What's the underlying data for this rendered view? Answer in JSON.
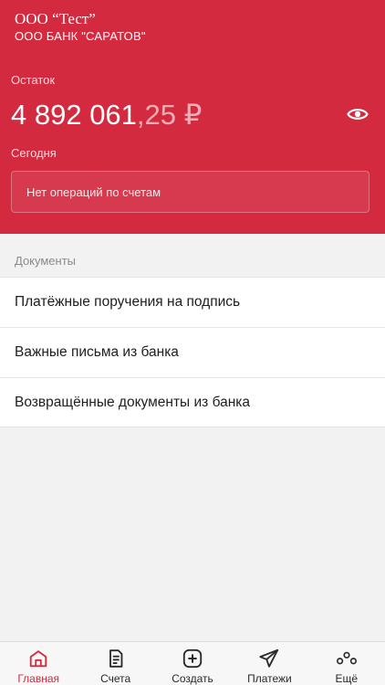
{
  "header": {
    "org_name": "ООО “Тест”",
    "bank_name": "ООО БАНК \"САРАТОВ\"",
    "balance_label": "Остаток",
    "balance_whole": "4 892 061",
    "balance_fraction": ",25 ₽",
    "today_label": "Сегодня",
    "no_operations": "Нет операций по счетам"
  },
  "documents": {
    "title": "Документы",
    "items": [
      {
        "label": "Платёжные поручения на подпись"
      },
      {
        "label": "Важные письма из банка"
      },
      {
        "label": "Возвращённые документы из банка"
      }
    ]
  },
  "tabs": [
    {
      "label": "Главная",
      "icon": "home-icon",
      "active": true
    },
    {
      "label": "Счета",
      "icon": "document-icon",
      "active": false
    },
    {
      "label": "Создать",
      "icon": "plus-square-icon",
      "active": false
    },
    {
      "label": "Платежи",
      "icon": "paper-plane-icon",
      "active": false
    },
    {
      "label": "Ещё",
      "icon": "more-circles-icon",
      "active": false
    }
  ],
  "colors": {
    "brand": "#d42a40",
    "tab_active": "#d42a40",
    "tab_inactive": "#2a2a2a"
  }
}
